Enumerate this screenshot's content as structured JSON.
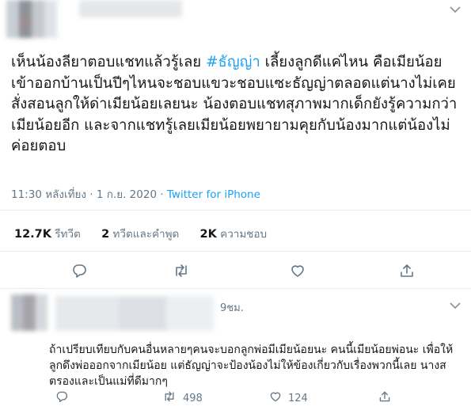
{
  "tweet": {
    "text_before": "เห็นน้องลียาตอบแชทแล้วรู้เลย ",
    "hashtag": "#ธัญญ่า",
    "text_after": " เลี้ยงลูกดีแค่ไหน คือเมียน้อยเข้าออกบ้านเป็นปีๆไหนจะชอบแขวะชอบแซะธัญญ่าตลอดแต่นางไม่เคยสั่งสอนลูกให้ด่าเมียน้อยเลยนะ น้องตอบแชทสุภาพมากเด็กยังรู้ความกว่าเมียน้อยอีก และจากแชทรู้เลยเมียน้อยพยายามคุยกับน้องมากแต่น้องไม่ค่อยตอบ",
    "time": "11:30 หลังเที่ยง · 1 ก.ย. 2020 · ",
    "source": "Twitter for iPhone"
  },
  "stats": {
    "retweets_count": "12.7K",
    "retweets_label": "รีทวีต",
    "quotes_count": "2",
    "quotes_label": "ทวีตและคำพูด",
    "likes_count": "2K",
    "likes_label": "ความชอบ"
  },
  "reply": {
    "time": "9ชม.",
    "text": "ถ้าเปรียบเทียบกับคนอื่นหลายๆคนจะบอกลูกพ่อมีเมียน้อยนะ คนนี้เมียน้อยพ่อนะ เพื่อให้ลูกดึงพ่อออกจากเมียน้อย แต่ธัญญ่าจะป้องน้องไม่ให้ข้องเกี่ยวกับเรื่องพวกนี้เลย นางสตรองและเป็นแม่ที่ดีมากๆ",
    "retweet_count": "498",
    "like_count": "124"
  },
  "icons": [
    "chevron-down-icon",
    "reply-icon",
    "retweet-icon",
    "like-icon",
    "share-icon"
  ],
  "colors": {
    "accent": "#1da1f2",
    "muted": "#657786",
    "divider": "#e6ecf0"
  }
}
